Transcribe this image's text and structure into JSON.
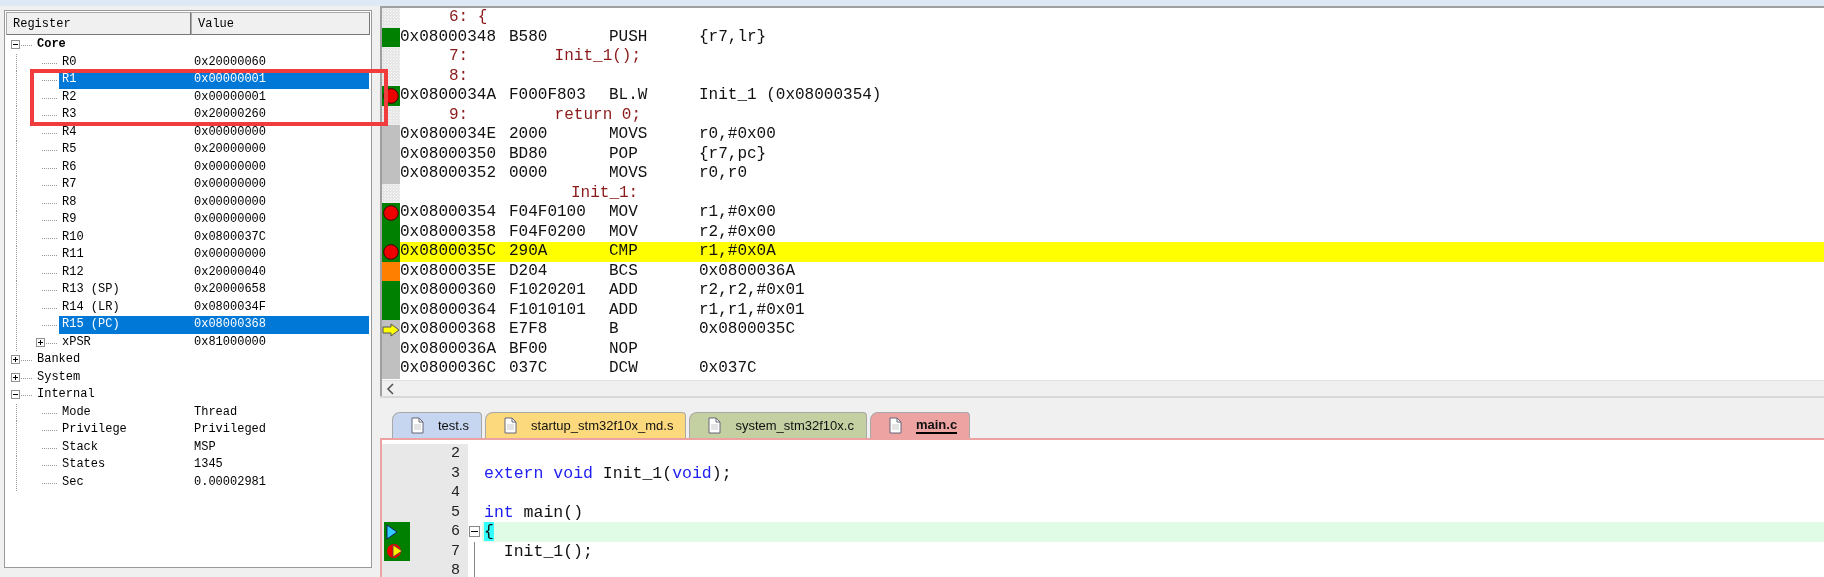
{
  "register_panel": {
    "columns": [
      "Register",
      "Value"
    ],
    "tree": [
      {
        "name": "Core",
        "emphasized": true,
        "expanded": true,
        "selected": false,
        "children": [
          {
            "name": "R0",
            "value": "0x20000060",
            "selected": false
          },
          {
            "name": "R1",
            "value": "0x00000001",
            "selected": true,
            "boxed": true
          },
          {
            "name": "R2",
            "value": "0x00000001",
            "selected": false,
            "boxed": true
          },
          {
            "name": "R3",
            "value": "0x20000260",
            "selected": false,
            "boxed": true
          },
          {
            "name": "R4",
            "value": "0x00000000",
            "selected": false
          },
          {
            "name": "R5",
            "value": "0x20000000",
            "selected": false
          },
          {
            "name": "R6",
            "value": "0x00000000",
            "selected": false
          },
          {
            "name": "R7",
            "value": "0x00000000",
            "selected": false
          },
          {
            "name": "R8",
            "value": "0x00000000",
            "selected": false
          },
          {
            "name": "R9",
            "value": "0x00000000",
            "selected": false
          },
          {
            "name": "R10",
            "value": "0x0800037C",
            "selected": false
          },
          {
            "name": "R11",
            "value": "0x00000000",
            "selected": false
          },
          {
            "name": "R12",
            "value": "0x20000040",
            "selected": false
          },
          {
            "name": "R13 (SP)",
            "value": "0x20000658",
            "selected": false
          },
          {
            "name": "R14 (LR)",
            "value": "0x0800034F",
            "selected": false
          },
          {
            "name": "R15 (PC)",
            "value": "0x08000368",
            "selected": true
          },
          {
            "name": "xPSR",
            "value": "0x81000000",
            "expanded": false,
            "selected": false
          }
        ]
      },
      {
        "name": "Banked",
        "emphasized": false,
        "expanded": false,
        "selected": false
      },
      {
        "name": "System",
        "emphasized": false,
        "expanded": false,
        "selected": false
      },
      {
        "name": "Internal",
        "emphasized": false,
        "expanded": true,
        "selected": false,
        "children": [
          {
            "name": "Mode",
            "value": "Thread",
            "selected": false
          },
          {
            "name": "Privilege",
            "value": "Privileged",
            "selected": false
          },
          {
            "name": "Stack",
            "value": "MSP",
            "selected": false
          },
          {
            "name": "States",
            "value": "1345",
            "selected": false
          },
          {
            "name": "Sec",
            "value": "0.00002981",
            "selected": false
          }
        ]
      }
    ]
  },
  "disassembly": {
    "lines": [
      {
        "kind": "source",
        "text": "6: {"
      },
      {
        "kind": "asm",
        "address": "0x08000348",
        "opcode": "B580",
        "mnemonic": "PUSH",
        "operand": "{r7,lr}",
        "color": "#008000"
      },
      {
        "kind": "source",
        "text": "7:         Init_1();"
      },
      {
        "kind": "source",
        "text": "8:"
      },
      {
        "kind": "asm",
        "address": "0x0800034A",
        "opcode": "F000F803",
        "mnemonic": "BL.W",
        "operand": "Init_1 (0x08000354)",
        "color": "#008000",
        "breakpoint": true
      },
      {
        "kind": "source",
        "text": "9:         return 0;"
      },
      {
        "kind": "asm",
        "address": "0x0800034E",
        "opcode": "2000",
        "mnemonic": "MOVS",
        "operand": "r0,#0x00",
        "color": "#c0c0c0"
      },
      {
        "kind": "asm",
        "address": "0x08000350",
        "opcode": "BD80",
        "mnemonic": "POP",
        "operand": "{r7,pc}",
        "color": "#c0c0c0"
      },
      {
        "kind": "asm",
        "address": "0x08000352",
        "opcode": "0000",
        "mnemonic": "MOVS",
        "operand": "r0,r0",
        "color": "#c0c0c0"
      },
      {
        "kind": "label",
        "text": "Init_1:"
      },
      {
        "kind": "asm",
        "address": "0x08000354",
        "opcode": "F04F0100",
        "mnemonic": "MOV",
        "operand": "r1,#0x00",
        "color": "#008000",
        "breakpoint": true
      },
      {
        "kind": "asm",
        "address": "0x08000358",
        "opcode": "F04F0200",
        "mnemonic": "MOV",
        "operand": "r2,#0x00",
        "color": "#008000"
      },
      {
        "kind": "asm",
        "address": "0x0800035C",
        "opcode": "290A",
        "mnemonic": "CMP",
        "operand": "r1,#0x0A",
        "color": "#008000",
        "breakpoint": true,
        "highlighted": true
      },
      {
        "kind": "asm",
        "address": "0x0800035E",
        "opcode": "D204",
        "mnemonic": "BCS",
        "operand": "0x0800036A",
        "color": "#ff8000"
      },
      {
        "kind": "asm",
        "address": "0x08000360",
        "opcode": "F1020201",
        "mnemonic": "ADD",
        "operand": "r2,r2,#0x01",
        "color": "#008000"
      },
      {
        "kind": "asm",
        "address": "0x08000364",
        "opcode": "F1010101",
        "mnemonic": "ADD",
        "operand": "r1,r1,#0x01",
        "color": "#008000"
      },
      {
        "kind": "asm",
        "address": "0x08000368",
        "opcode": "E7F8",
        "mnemonic": "B",
        "operand": "0x0800035C",
        "color": "#c0c0c0",
        "current": true
      },
      {
        "kind": "asm",
        "address": "0x0800036A",
        "opcode": "BF00",
        "mnemonic": "NOP",
        "color": "#c0c0c0"
      },
      {
        "kind": "asm",
        "address": "0x0800036C",
        "opcode": "037C",
        "mnemonic": "DCW",
        "operand": "0x037C",
        "color": "#c0c0c0"
      }
    ]
  },
  "editor": {
    "tabs": [
      {
        "label": "test.s",
        "color": "#c7d6f0",
        "selected": false
      },
      {
        "label": "startup_stm32f10x_md.s",
        "color": "#fdd97e",
        "selected": false
      },
      {
        "label": "system_stm32f10x.c",
        "color": "#c4d0a2",
        "selected": false
      },
      {
        "label": "main.c",
        "color": "#eea3a3",
        "selected": true
      }
    ],
    "lines": [
      {
        "number": "2"
      },
      {
        "number": "3",
        "tokens": [
          {
            "text": "extern",
            "kind": "keyword"
          },
          {
            "text": " void",
            "kind": "keyword"
          },
          {
            "text": " Init_1(",
            "kind": "plain"
          },
          {
            "text": "void",
            "kind": "keyword"
          },
          {
            "text": ");",
            "kind": "plain"
          }
        ]
      },
      {
        "number": "4"
      },
      {
        "number": "5",
        "tokens": [
          {
            "text": "int",
            "kind": "keyword"
          },
          {
            "text": " main()",
            "kind": "plain"
          }
        ]
      },
      {
        "number": "6",
        "covered": true,
        "caller": true,
        "foldable": true,
        "highlighted": true,
        "cursor": true,
        "tokens": [
          {
            "text": "{",
            "kind": "plain"
          }
        ]
      },
      {
        "number": "7",
        "covered": true,
        "breakpoint": true,
        "tokens": [
          {
            "text": "  Init_1();",
            "kind": "plain"
          }
        ]
      },
      {
        "number": "8"
      }
    ]
  }
}
